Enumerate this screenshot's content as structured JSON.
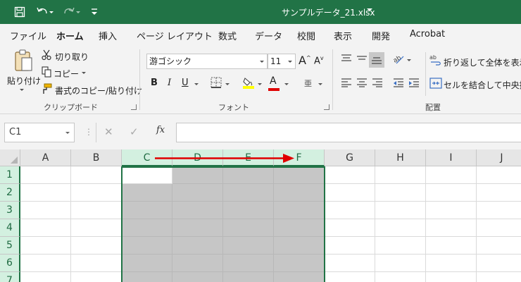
{
  "titlebar": {
    "title": "サンプルデータ_21.xlsx",
    "icons": [
      "save-icon",
      "undo-icon",
      "redo-icon",
      "customize-qat-icon"
    ],
    "accent": "#217346"
  },
  "menu": {
    "tabs": [
      "ファイル",
      "ホーム",
      "挿入",
      "ページ レイアウト",
      "数式",
      "データ",
      "校閲",
      "表示",
      "開発",
      "Acrobat"
    ],
    "active": "ホーム"
  },
  "ribbon": {
    "clipboard": {
      "paste_label": "貼り付け",
      "cut_label": "切り取り",
      "copy_label": "コピー",
      "format_painter_label": "書式のコピー/貼り付け",
      "group_label": "クリップボード"
    },
    "font": {
      "font_name": "游ゴシック",
      "font_size": "11",
      "grow_label": "A",
      "shrink_label": "A",
      "bold_label": "B",
      "italic_label": "I",
      "underline_label": "U",
      "font_color_label": "A",
      "phonetic_label": "亜",
      "group_label": "フォント",
      "highlight_color": "#ffff00",
      "font_color": "#e00000"
    },
    "alignment": {
      "wrap_text_label": "折り返して全体を表示す",
      "merge_center_label": "セルを結合して中央揃え",
      "group_label": "配置"
    }
  },
  "formula_bar": {
    "name_box": "C1",
    "fx_label": "fx",
    "formula": ""
  },
  "grid": {
    "columns": [
      "A",
      "B",
      "C",
      "D",
      "E",
      "F",
      "G",
      "H",
      "I",
      "J"
    ],
    "rows": [
      "1",
      "2",
      "3",
      "4",
      "5",
      "6",
      "7"
    ],
    "selected_columns": [
      "C",
      "D",
      "E",
      "F"
    ],
    "active_cell": "C1",
    "annotation": {
      "type": "arrow",
      "from_column": "C",
      "to_column": "F",
      "color": "#e00000"
    }
  }
}
